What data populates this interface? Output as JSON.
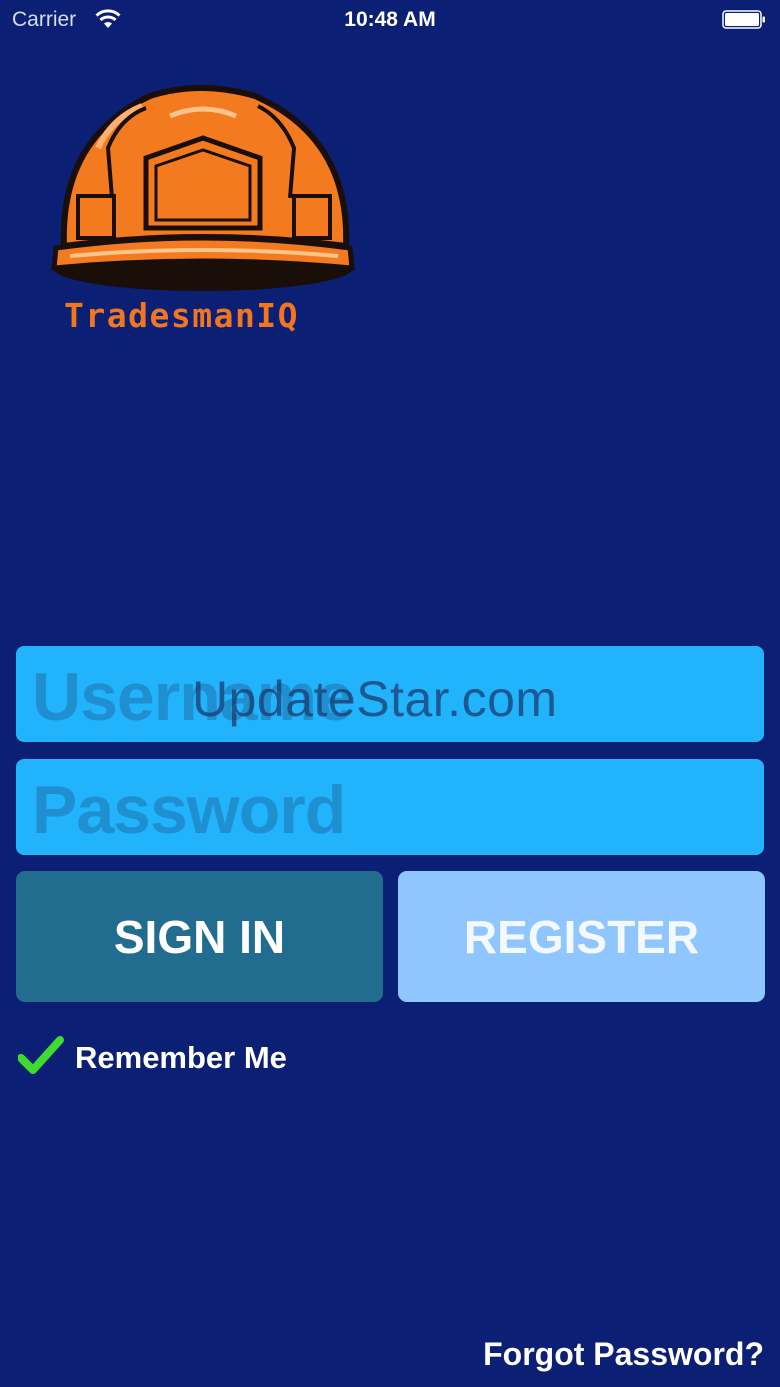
{
  "status_bar": {
    "carrier": "Carrier",
    "time": "10:48 AM",
    "wifi_icon": "wifi-icon",
    "battery_icon": "battery-full-icon"
  },
  "logo": {
    "icon": "hard-hat-icon",
    "brand": "TradesmanIQ",
    "colors": {
      "helmet": "#f47a20",
      "brand_text": "#f2751f"
    }
  },
  "form": {
    "username_placeholder": "Username",
    "password_placeholder": "Password",
    "sign_in_label": "SIGN IN",
    "register_label": "REGISTER",
    "remember_me_label": "Remember Me",
    "remember_me_checked": true,
    "forgot_password_label": "Forgot Password?"
  },
  "watermark": "UpdateStar.com",
  "colors": {
    "background": "#0b1f74",
    "field": "#22b3fd",
    "sign_in": "#226d8f",
    "register": "#90c6ff",
    "check": "#3ddc2f"
  }
}
